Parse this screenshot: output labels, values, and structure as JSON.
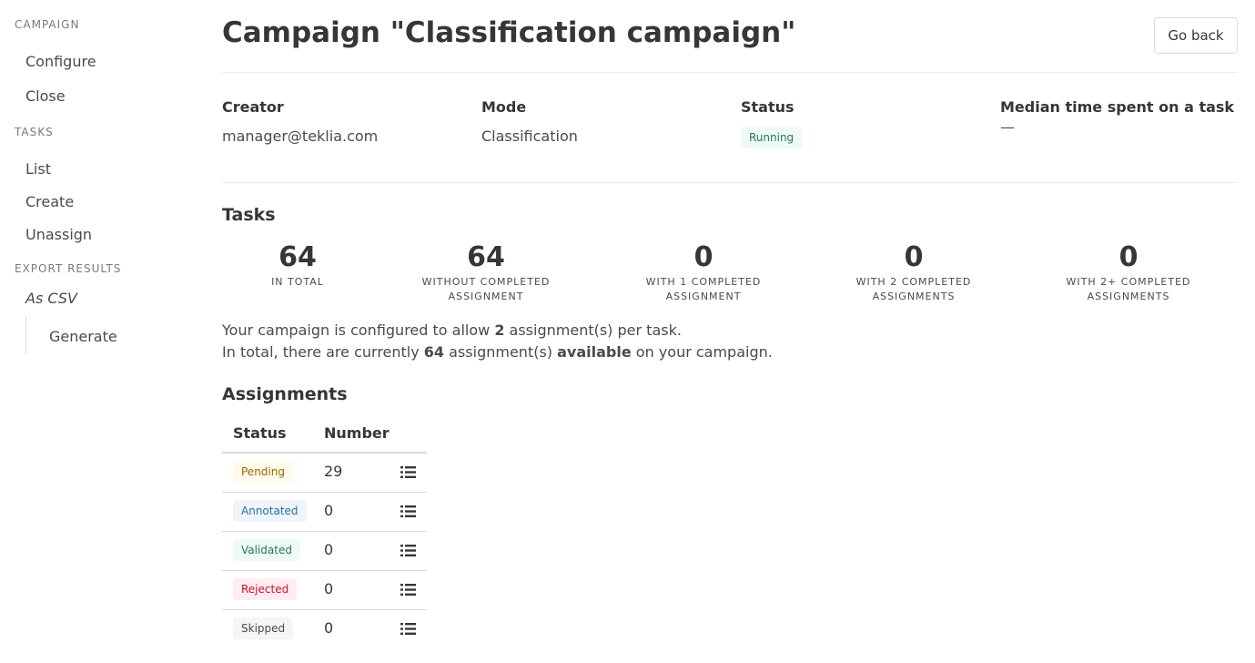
{
  "sidebar": {
    "campaign_label": "CAMPAIGN",
    "configure": "Configure",
    "close": "Close",
    "tasks_label": "TASKS",
    "list": "List",
    "create": "Create",
    "unassign": "Unassign",
    "export_label": "EXPORT RESULTS",
    "as_csv": "As CSV",
    "generate": "Generate"
  },
  "header": {
    "title": "Campaign \"Classification campaign\"",
    "go_back": "Go back"
  },
  "info": {
    "creator_label": "Creator",
    "creator_value": "manager@teklia.com",
    "mode_label": "Mode",
    "mode_value": "Classification",
    "status_label": "Status",
    "status_value": "Running",
    "median_label": "Median time spent on a task",
    "median_value": "—"
  },
  "tasks": {
    "title": "Tasks",
    "stats": [
      {
        "value": "64",
        "label_1": "IN TOTAL",
        "label_2": ""
      },
      {
        "value": "64",
        "label_1": "WITHOUT COMPLETED",
        "label_2": "ASSIGNMENT"
      },
      {
        "value": "0",
        "label_1": "WITH 1 COMPLETED",
        "label_2": "ASSIGNMENT"
      },
      {
        "value": "0",
        "label_1": "WITH 2 COMPLETED",
        "label_2": "ASSIGNMENTS"
      },
      {
        "value": "0",
        "label_1": "WITH 2+ COMPLETED",
        "label_2": "ASSIGNMENTS"
      }
    ],
    "line1_a": "Your campaign is configured to allow ",
    "line1_b": "2",
    "line1_c": " assignment(s) per task.",
    "line2_a": "In total, there are currently ",
    "line2_b": "64",
    "line2_c": " assignment(s) ",
    "line2_d": "available",
    "line2_e": " on your campaign."
  },
  "assignments": {
    "title": "Assignments",
    "col_status": "Status",
    "col_number": "Number",
    "rows": [
      {
        "status": "Pending",
        "number": "29",
        "icon": "list-icon"
      },
      {
        "status": "Annotated",
        "number": "0",
        "icon": "list-icon"
      },
      {
        "status": "Validated",
        "number": "0",
        "icon": "list-icon"
      },
      {
        "status": "Rejected",
        "number": "0",
        "icon": "list-icon"
      },
      {
        "status": "Skipped",
        "number": "0",
        "icon": "list-icon"
      }
    ]
  },
  "colors": {
    "running": "#257953",
    "pending": "#946c00",
    "annotated": "#296fa8",
    "validated": "#257953",
    "rejected": "#cc0f35",
    "skipped": "#4a4a4a"
  }
}
